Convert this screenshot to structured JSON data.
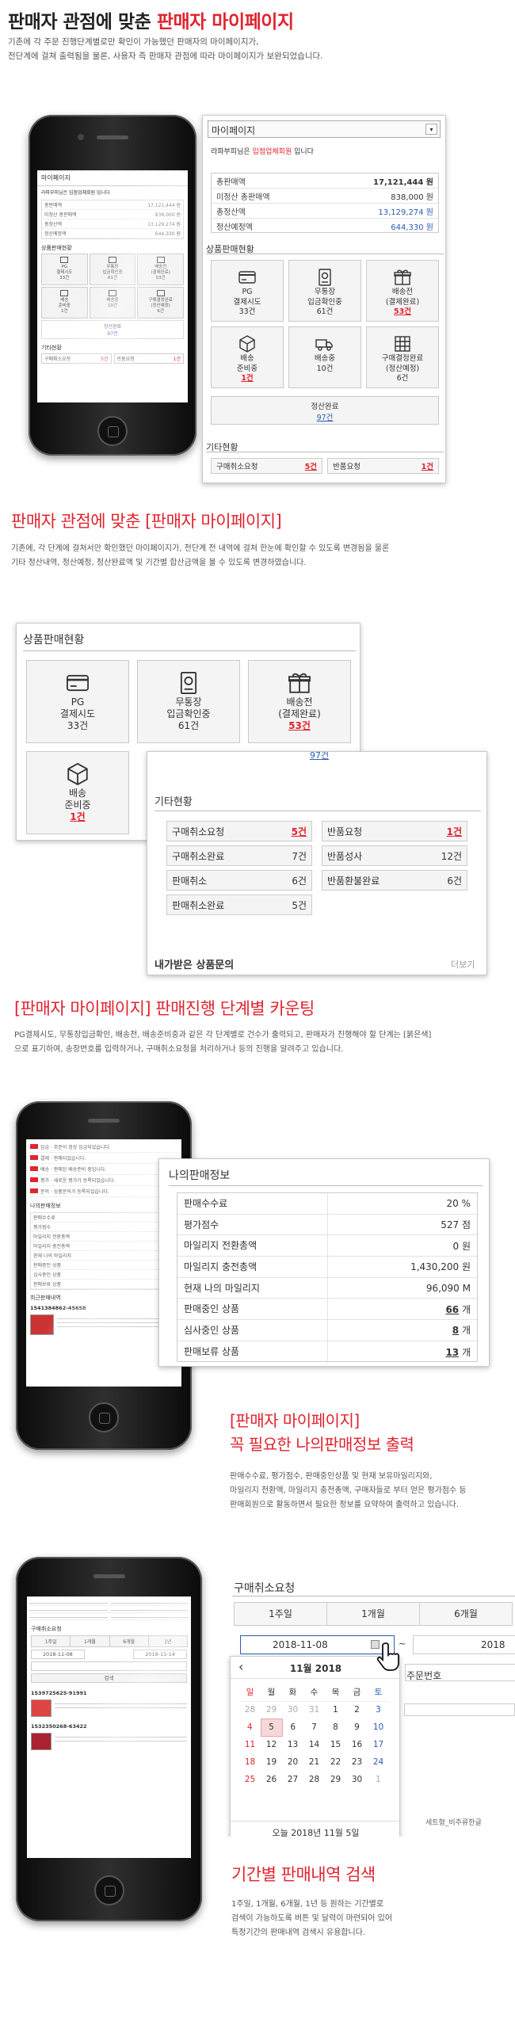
{
  "section1": {
    "title_prefix": "판매자 관점에 맞춘 ",
    "title_highlight": "판매자 마이페이지",
    "desc_line1": "기존에 각 주문 진행단계별로만 확인이 가능했던 판매자의 마이페이지가,",
    "desc_line2": "전단계에 걸쳐 출력됨을 물론, 사용자 즉 판매자 관점에 따라 마이페이지가 보완되었습니다."
  },
  "mypage_panel": {
    "title": "마이페이지",
    "greeting_name": "라파부피",
    "greeting_mid": "님은 ",
    "greeting_grade": "입점업체회원",
    "greeting_end": " 입니다",
    "rows": [
      {
        "label": "총판매액",
        "value": "17,121,444",
        "unit": "원",
        "color": "#333"
      },
      {
        "label": "미정산 총판매액",
        "value": "838,000",
        "unit": "원",
        "color": "#333"
      },
      {
        "label": "총정산액",
        "value": "13,129,274",
        "unit": "원",
        "color": "#2a5db0"
      },
      {
        "label": "정산예정액",
        "value": "644,330",
        "unit": "원",
        "color": "#2a5db0"
      }
    ],
    "status_title": "상품판매현황",
    "tiles": [
      {
        "icon": "card-icon",
        "line1": "PG",
        "line2": "결제시도",
        "count": "33건",
        "red": false
      },
      {
        "icon": "receipt-icon",
        "line1": "무통장",
        "line2": "입금확인중",
        "count": "61건",
        "red": false
      },
      {
        "icon": "gift-icon",
        "line1": "배송전",
        "line2": "(결제완료)",
        "count": "53건",
        "red": true
      },
      {
        "icon": "box-icon",
        "line1": "배송",
        "line2": "준비중",
        "count": "1건",
        "red": true
      },
      {
        "icon": "truck-icon",
        "line1": "배송중",
        "line2": "",
        "count": "10건",
        "red": false
      },
      {
        "icon": "grid-icon",
        "line1": "구매결정완료",
        "line2": "(정산예정)",
        "count": "6건",
        "red": false
      }
    ],
    "settle_label": "정산완료",
    "settle_count": "97건",
    "etc_title": "기타현황",
    "etc_rows": [
      {
        "label": "구매취소요청",
        "value": "5건",
        "red": true
      },
      {
        "label": "반품요청",
        "value": "1건",
        "red": true
      }
    ]
  },
  "section2": {
    "title": "판매자 관점에 맞춘 [판매자 마이페이지]",
    "desc_line1": "기존에, 각 단계에 걸쳐서만 확인했던 마이페이지가, 전단계 전 내역에 걸쳐 한눈에 확인할 수 있도록 변경됨을 물론",
    "desc_line2": "기타 정산내역, 정산예정, 정산완료액 및 기간별 합산금액을 볼 수 있도록 변경하였습니다."
  },
  "etc_panel": {
    "title": "기타현황",
    "rows": [
      {
        "l1": "구매취소요청",
        "v1": "5건",
        "r1": true,
        "l2": "반품요청",
        "v2": "1건",
        "r2": true
      },
      {
        "l1": "구매취소완료",
        "v1": "7건",
        "r1": false,
        "l2": "반품성사",
        "v2": "12건",
        "r2": false
      },
      {
        "l1": "판매취소",
        "v1": "6건",
        "r1": false,
        "l2": "반품환불완료",
        "v2": "6건",
        "r2": false
      },
      {
        "l1": "판매취소완료",
        "v1": "5건",
        "r1": false,
        "l2": "",
        "v2": "",
        "r2": false
      }
    ],
    "inquiry_title": "내가받은 상품문의",
    "more_label": "더보기"
  },
  "section3": {
    "title": "[판매자 마이페이지] 판매진행 단계별 카운팅",
    "desc_line1": "PG결제시도, 무통장입금확인, 배송전, 배송준비중과 같은 각 단계별로 건수가 출력되고, 판매자가 진행해야 할 단계는 [붉은색]",
    "desc_line2": "으로 표기하여, 송장번호를 입력하거나, 구매취소요청을 처리하거나 등의 진행을 알려주고 있습니다."
  },
  "myinfo_panel": {
    "title": "나의판매정보",
    "rows": [
      {
        "label": "판매수수료",
        "value": "20",
        "unit": "%",
        "link": false
      },
      {
        "label": "평가점수",
        "value": "527",
        "unit": "점",
        "link": false
      },
      {
        "label": "마일리지 전환총액",
        "value": "0",
        "unit": "원",
        "link": false
      },
      {
        "label": "마일리지 충전총액",
        "value": "1,430,200",
        "unit": "원",
        "link": false
      },
      {
        "label": "현재 나의 마일리지",
        "value": "96,090",
        "unit": "M",
        "link": false
      },
      {
        "label": "판매중인 상품",
        "value": "66",
        "unit": "개",
        "link": true
      },
      {
        "label": "심사중인 상품",
        "value": "8",
        "unit": "개",
        "link": true
      },
      {
        "label": "판매보류 상품",
        "value": "13",
        "unit": "개",
        "link": true
      }
    ]
  },
  "section4": {
    "title_line1": "[판매자 마이페이지]",
    "title_line2": "꼭 필요한 나의판매정보 출력",
    "desc_line1": "판매수수료, 평가점수, 판매중인상품 및 현재 보유마일리지와,",
    "desc_line2": "마일리지 전환액, 마일리지 충전총액, 구매자들로 부터 얻은 평가점수 등",
    "desc_line3": "판매회원으로 활동하면서 필요한 정보를 요약하여 출력하고 있습니다."
  },
  "cancel_panel": {
    "title": "구매취소요청",
    "tabs": [
      "1주일",
      "1개월",
      "6개월"
    ],
    "date_value": "2018-11-08",
    "tilde": "~",
    "date2_partial": "2018",
    "order_no_label": "주문번호",
    "calendar": {
      "month_label": "11월 2018",
      "prev": "‹",
      "next": "›",
      "weekdays": [
        "일",
        "월",
        "화",
        "수",
        "목",
        "금",
        "토"
      ],
      "weeks": [
        [
          "28",
          "29",
          "30",
          "31",
          "1",
          "2",
          "3"
        ],
        [
          "4",
          "5",
          "6",
          "7",
          "8",
          "9",
          "10"
        ],
        [
          "11",
          "12",
          "13",
          "14",
          "15",
          "16",
          "17"
        ],
        [
          "18",
          "19",
          "20",
          "21",
          "22",
          "23",
          "24"
        ],
        [
          "25",
          "26",
          "27",
          "28",
          "29",
          "30",
          "1"
        ]
      ],
      "today_label": "오늘 2018년 11월 5일"
    },
    "item_snippet": "세트형_비주류한글"
  },
  "section5": {
    "title": "기간별 판매내역 검색",
    "desc_line1": "1주일, 1개월, 6개월, 1년 등 원하는 기간별로",
    "desc_line2": "검색이 가능하도록 버튼 및 달력이 마련되어 있어",
    "desc_line3": "특정기간의 판매내역 검색시 유용합니다."
  },
  "phone1_screen": {
    "title": "마이페이지",
    "greeting": "라파부피님은 입점업체회원 입니다",
    "rows": [
      {
        "label": "총판매액",
        "value": "17,121,444 원"
      },
      {
        "label": "미정산 총판매액",
        "value": "838,000 원"
      },
      {
        "label": "총정산액",
        "value": "13,129,274 원"
      },
      {
        "label": "정산예정액",
        "value": "644,330 원"
      }
    ],
    "status_title": "상품판매현황",
    "tiles": [
      {
        "line1": "PG",
        "line2": "결제시도",
        "count": "33건"
      },
      {
        "line1": "무통장",
        "line2": "입금확인중",
        "count": "61건"
      },
      {
        "line1": "배송전",
        "line2": "(결제완료)",
        "count": "53건"
      },
      {
        "line1": "배송",
        "line2": "준비중",
        "count": "1건"
      },
      {
        "line1": "배송중",
        "line2": "",
        "count": "10건"
      },
      {
        "line1": "구매결정완료",
        "line2": "(정산예정)",
        "count": "6건"
      }
    ],
    "settle": "정산완료",
    "settle_count": "97건",
    "etc_title": "기타현황",
    "etc_rows": [
      {
        "label": "구매취소요청",
        "value": "5건"
      },
      {
        "label": "반품요청",
        "value": "1건"
      }
    ]
  },
  "phone2_screen": {
    "list": [
      "입금 · 주문이 정상 입금되었습니다.",
      "결제 · 판매되었습니다.",
      "배송 · 판매된 배송준비 중입니다.",
      "평가 · 새로운 평가가 등록되었습니다.",
      "문의 · 상품문의가 등록되었습니다."
    ],
    "info_title": "나의판매정보",
    "info_rows": [
      "판매수수료",
      "평가점수",
      "마일리지 전환총액",
      "마일리지 충전총액",
      "현재 나의 마일리지",
      "판매중인 상품",
      "심사중인 상품",
      "판매보류 상품"
    ],
    "recent_title": "최근판매내역",
    "order_no": "1541384862-45658"
  },
  "phone3_screen": {
    "title": "구매취소요청",
    "tabs": [
      "1주일",
      "1개월",
      "6개월",
      "1년"
    ],
    "date_from": "2018-11-08",
    "date_to": "2018-11-14",
    "search_btn": "검색",
    "order1": "1539725625-91991",
    "order2": "1532350268-63422"
  }
}
